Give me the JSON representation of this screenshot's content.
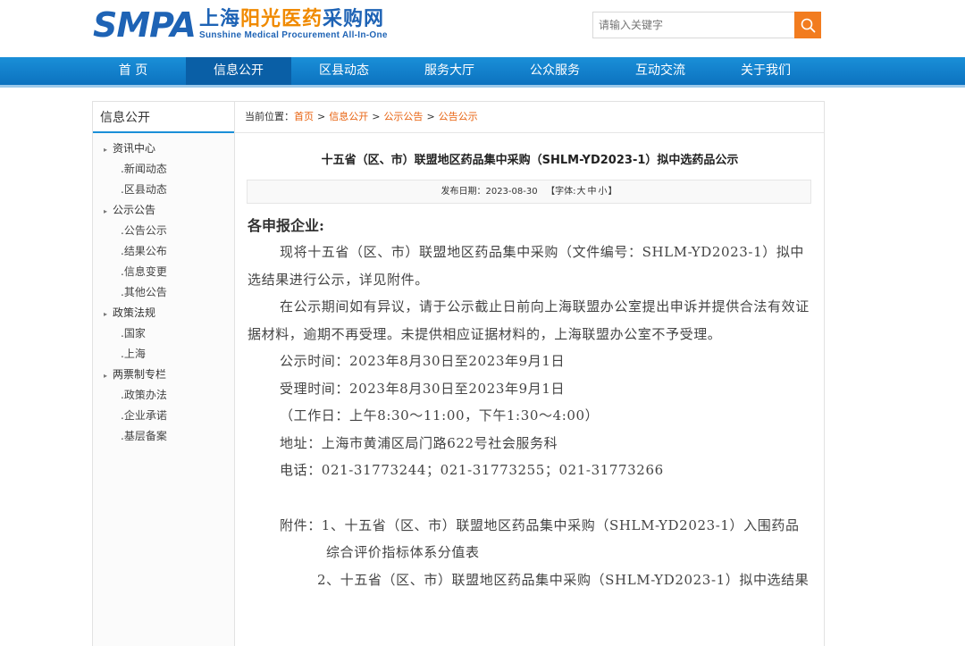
{
  "header": {
    "logo_smpa": "SMPA",
    "logo_cn_blue": "上海",
    "logo_cn_orange": "阳光医药",
    "logo_cn_blue2": "采购网",
    "logo_en": "Sunshine Medical Procurement All-In-One",
    "search_placeholder": "请输入关键字",
    "search_icon": "search-icon",
    "brand_blue": "#1e63b5",
    "brand_orange": "#f08a00"
  },
  "nav": {
    "items": [
      "首 页",
      "信息公开",
      "区县动态",
      "服务大厅",
      "公众服务",
      "互动交流",
      "关于我们"
    ],
    "active_index": 1,
    "color": "#0c72bf"
  },
  "sidebar": {
    "title": "信息公开",
    "groups": [
      {
        "label": "资讯中心",
        "items": [
          ".新闻动态",
          ".区县动态"
        ]
      },
      {
        "label": "公示公告",
        "items": [
          ".公告公示",
          ".结果公布",
          ".信息变更",
          ".其他公告"
        ]
      },
      {
        "label": "政策法规",
        "items": [
          ".国家",
          ".上海"
        ]
      },
      {
        "label": "两票制专栏",
        "items": [
          ".政策办法",
          ".企业承诺",
          ".基层备案"
        ]
      }
    ]
  },
  "breadcrumb": {
    "prefix": "当前位置：",
    "items": [
      "首页",
      "信息公开",
      "公示公告",
      "公告公示"
    ],
    "sep": ">"
  },
  "article": {
    "title": "十五省（区、市）联盟地区药品集中采购（SHLM-YD2023-1）拟中选药品公示",
    "publish_label": "发布日期：",
    "publish_date": "2023-08-30",
    "font_label_open": "【字体:",
    "font_large": "大",
    "font_medium": "中",
    "font_small": "小",
    "font_label_close": "】",
    "salutation": "各申报企业:",
    "para1": "现将十五省（区、市）联盟地区药品集中采购（文件编号：SHLM-YD2023-1）拟中选结果进行公示，详见附件。",
    "para2": "在公示期间如有异议，请于公示截止日前向上海联盟办公室提出申诉并提供合法有效证据材料，逾期不再受理。未提供相应证据材料的，上海联盟办公室不予受理。",
    "line_publicity": "公示时间：2023年8月30日至2023年9月1日",
    "line_accept": "受理时间：2023年8月30日至2023年9月1日",
    "line_workday": "（工作日：上午8:30～11:00，下午1:30～4:00）",
    "line_address": "地址：上海市黄浦区局门路622号社会服务科",
    "line_phone": "电话：021-31773244；021-31773255；021-31773266",
    "attach1": "附件：1、十五省（区、市）联盟地区药品集中采购（SHLM-YD2023-1）入围药品综合评价指标体系分值表",
    "attach2": "2、十五省（区、市）联盟地区药品集中采购（SHLM-YD2023-1）拟中选结果"
  }
}
